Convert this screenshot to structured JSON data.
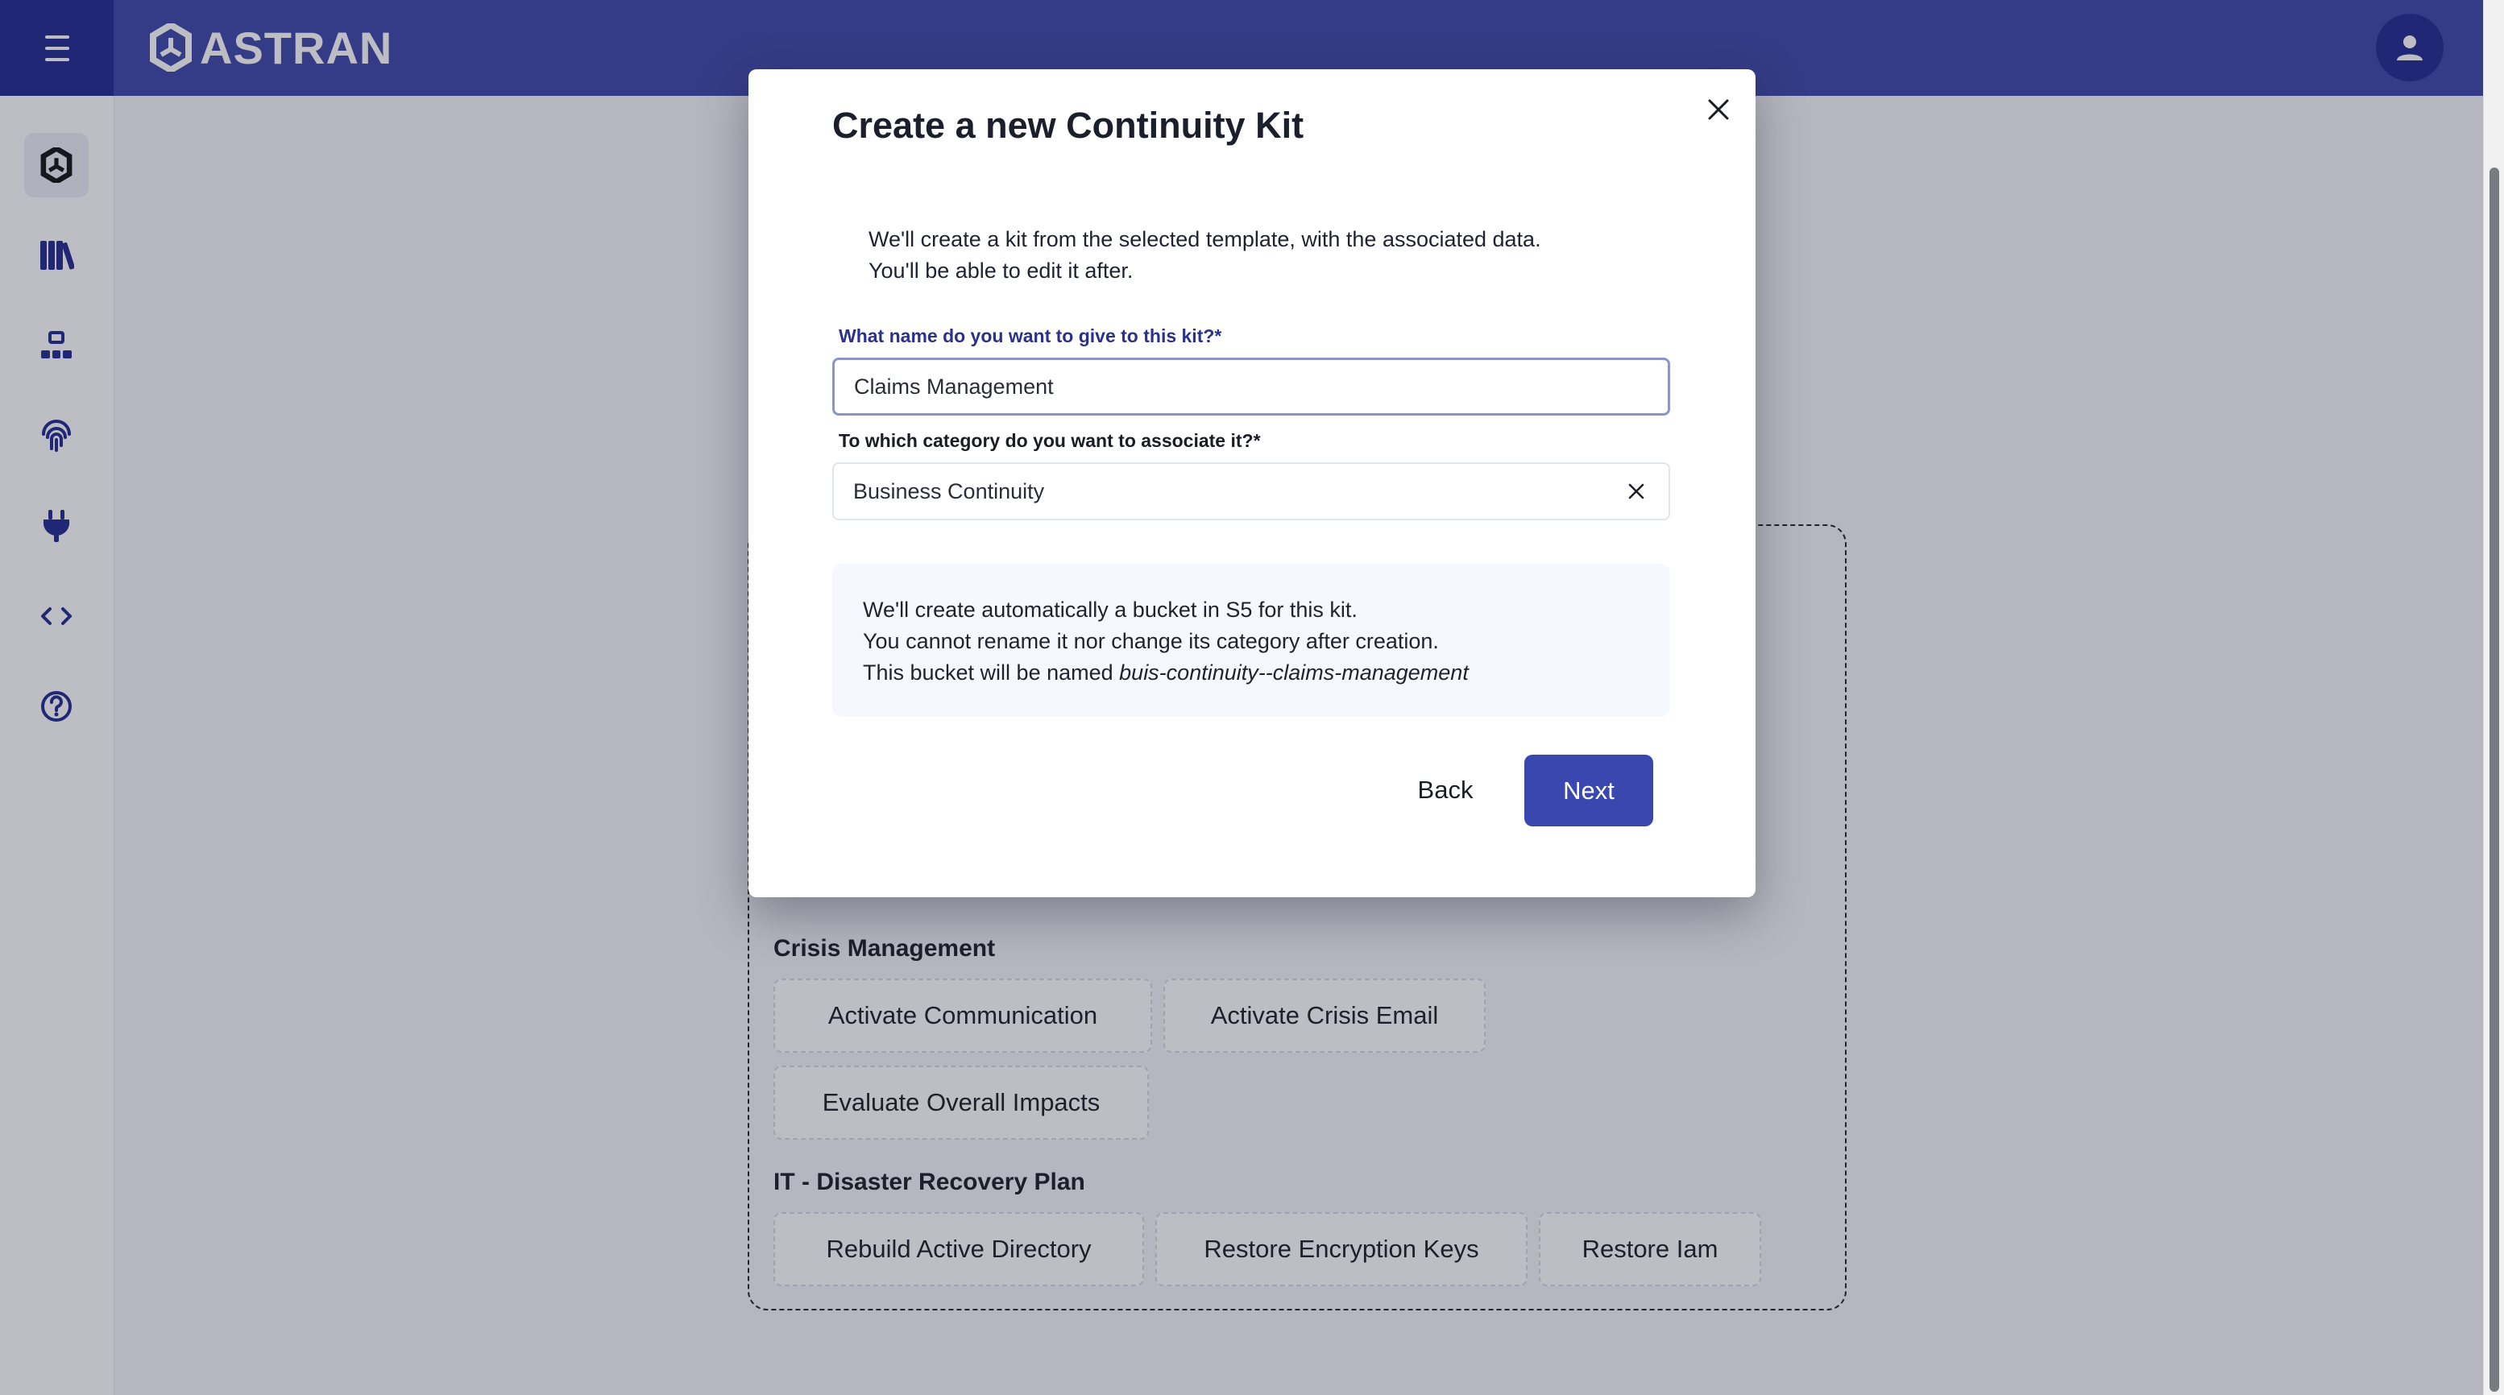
{
  "app": {
    "brand": "ASTRAN",
    "colors": {
      "primary": "#3d47a8",
      "primary_dark": "#1f2a8f",
      "button": "#3a47ae"
    }
  },
  "sidebar": {
    "items": [
      {
        "icon": "astran-logo-icon",
        "active": true
      },
      {
        "icon": "library-books-icon",
        "active": false
      },
      {
        "icon": "sitemap-icon",
        "active": false
      },
      {
        "icon": "fingerprint-icon",
        "active": false
      },
      {
        "icon": "plug-icon",
        "active": false
      },
      {
        "icon": "code-brackets-icon",
        "active": false
      },
      {
        "icon": "help-circle-icon",
        "active": false
      }
    ]
  },
  "background": {
    "groups": [
      {
        "title": "Crisis Management",
        "items": [
          "Activate Communication",
          "Activate Crisis Email",
          "Evaluate Overall Impacts"
        ]
      },
      {
        "title": "IT - Disaster Recovery Plan",
        "items": [
          "Rebuild Active Directory",
          "Restore Encryption Keys",
          "Restore Iam"
        ]
      }
    ]
  },
  "modal": {
    "title": "Create a new Continuity Kit",
    "intro_line1": "We'll create a kit from the selected template, with the associated data.",
    "intro_line2": "You'll be able to edit it after.",
    "name_label": "What name do you want to give to this kit?*",
    "name_value": "Claims Management",
    "category_label": "To which category do you want to associate it?*",
    "category_value": "Business Continuity",
    "info_line1": "We'll create automatically a bucket in S5 for this kit.",
    "info_line2": "You cannot rename it nor change its category after creation.",
    "info_line3_prefix": "This bucket will be named ",
    "bucket_name": "buis-continuity--claims-management",
    "back_label": "Back",
    "next_label": "Next"
  }
}
